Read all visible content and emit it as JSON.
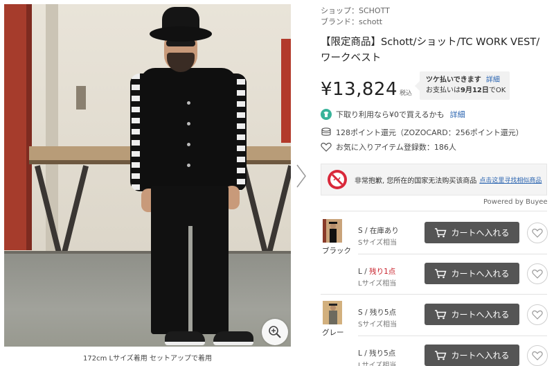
{
  "photo": {
    "caption": "172cm Lサイズ着用 セットアップで着用"
  },
  "product": {
    "shop": "ショップ：SCHOTT",
    "brand": "ブランド：schott",
    "title": "【限定商品】Schott/ショット/TC WORK VEST/ワークベスト",
    "price": "¥13,824",
    "tax_label": "税込"
  },
  "tsuke": {
    "headline": "ツケ払いできます",
    "link": "詳細",
    "line2_prefix": "お支払いは",
    "line2_date": "9月12日",
    "line2_suffix": "でOK"
  },
  "trade_in": {
    "text": "下取り利用なら¥0で買えるかも",
    "link": "詳細"
  },
  "points": {
    "text": "128ポイント還元（ZOZOCARD：256ポイント還元）"
  },
  "favorites": {
    "text": "お気に入りアイテム登録数：186人"
  },
  "notice": {
    "text": "非常抱歉, 您所在的国家无法购买该商品",
    "link": "点击这里寻找相似商品",
    "powered": "Powered by Buyee"
  },
  "cart_label": "カートへ入れる",
  "skus": [
    {
      "color": "ブラック",
      "variants": [
        {
          "stock_prefix": "S / ",
          "stock_status": "在庫あり",
          "low": false,
          "size_note": "Sサイズ相当"
        },
        {
          "stock_prefix": "L / ",
          "stock_status": "残り1点",
          "low": true,
          "size_note": "Lサイズ相当"
        }
      ]
    },
    {
      "color": "グレー",
      "variants": [
        {
          "stock_prefix": "S / ",
          "stock_status": "残り5点",
          "low": false,
          "size_note": "Sサイズ相当"
        },
        {
          "stock_prefix": "L / ",
          "stock_status": "残り5点",
          "low": false,
          "size_note": "Lサイズ相当"
        }
      ]
    }
  ],
  "colors": {
    "cart_button": "#555555",
    "link": "#2a64b0",
    "low_stock": "#c8202a",
    "trade_in_icon": "#39b39a"
  },
  "icons": [
    "zoom-in-icon",
    "chevron-right-icon",
    "tshirt-icon",
    "coins-icon",
    "heart-icon",
    "no-entry-icon",
    "cart-icon"
  ]
}
